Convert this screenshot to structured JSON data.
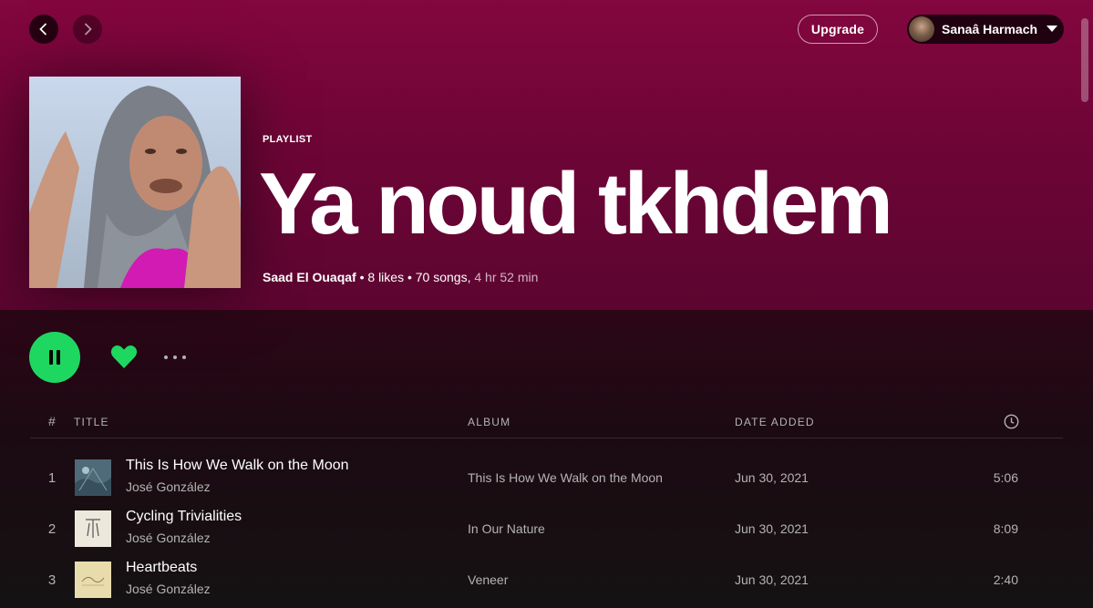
{
  "topbar": {
    "back_icon": "chevron-left-icon",
    "forward_icon": "chevron-right-icon",
    "upgrade_label": "Upgrade",
    "user_name": "Sanaâ Harmach",
    "user_caret_icon": "caret-down-icon"
  },
  "playlist": {
    "type_label": "PLAYLIST",
    "title": "Ya noud tkhdem",
    "owner": "Saad El Ouaqaf",
    "separator": " • ",
    "likes": "8 likes",
    "songs": "70 songs,",
    "duration": " 4 hr 52 min"
  },
  "controls": {
    "play_pause_icon": "pause-icon",
    "like_icon": "heart-icon",
    "more_icon": "more-options-icon"
  },
  "colors": {
    "header_gradient_top": "#83063f",
    "accent_green": "#1ed760"
  },
  "table": {
    "headers": {
      "hash": "#",
      "title": "Title",
      "album": "Album",
      "date_added": "Date added",
      "duration_icon": "clock-icon"
    },
    "rows": [
      {
        "num": "1",
        "title": "This Is How We Walk on the Moon",
        "artist": "José González",
        "album": "This Is How We Walk on the Moon",
        "date": "Jun 30, 2021",
        "duration": "5:06"
      },
      {
        "num": "2",
        "title": "Cycling Trivialities",
        "artist": "José González",
        "album": "In Our Nature",
        "date": "Jun 30, 2021",
        "duration": "8:09"
      },
      {
        "num": "3",
        "title": "Heartbeats",
        "artist": "José González",
        "album": "Veneer",
        "date": "Jun 30, 2021",
        "duration": "2:40"
      }
    ]
  }
}
